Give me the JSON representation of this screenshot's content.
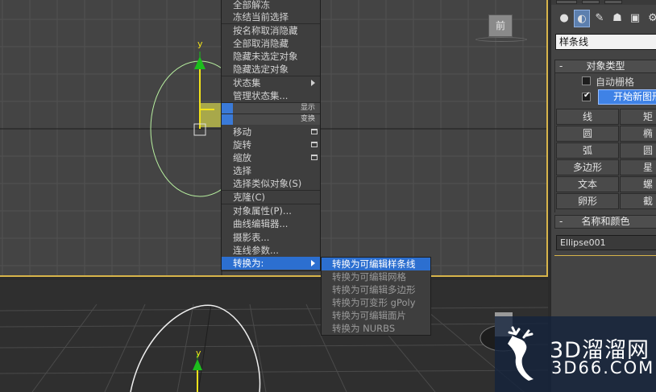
{
  "viewport_top": {
    "view_cube_label": "前",
    "axis_y_label": "y"
  },
  "viewport_persp": {
    "axis_y_label": "y"
  },
  "quad_menu": {
    "items": [
      {
        "label": "全部解冻"
      },
      {
        "label": "冻结当前选择"
      },
      {
        "label": "按名称取消隐藏"
      },
      {
        "label": "全部取消隐藏"
      },
      {
        "label": "隐藏未选定对象"
      },
      {
        "label": "隐藏选定对象"
      },
      {
        "label": "状态集"
      },
      {
        "label": "管理状态集..."
      }
    ],
    "display_header": "显示",
    "transform_header": "变换",
    "transform_items": [
      {
        "label": "移动"
      },
      {
        "label": "旋转"
      },
      {
        "label": "缩放"
      },
      {
        "label": "选择"
      },
      {
        "label": "选择类似对象(S)"
      },
      {
        "label": "克隆(C)"
      },
      {
        "label": "对象属性(P)..."
      },
      {
        "label": "曲线编辑器..."
      },
      {
        "label": "摄影表..."
      },
      {
        "label": "连线参数..."
      },
      {
        "label": "转换为:"
      }
    ]
  },
  "submenu": {
    "items": [
      {
        "label": "转换为可编辑样条线"
      },
      {
        "label": "转换为可编辑网格"
      },
      {
        "label": "转换为可编辑多边形"
      },
      {
        "label": "转换为可变形 gPoly"
      },
      {
        "label": "转换为可编辑面片"
      },
      {
        "label": "转换为 NURBS"
      }
    ]
  },
  "command_panel": {
    "category_dropdown": "样条线",
    "object_type": {
      "title": "对象类型",
      "autogrid_label": "自动栅格",
      "start_new_shape_label": "开始新图形",
      "buttons": [
        {
          "left": "线",
          "right": "矩形"
        },
        {
          "left": "圆",
          "right": "椭圆"
        },
        {
          "left": "弧",
          "right": "圆环"
        },
        {
          "left": "多边形",
          "right": "星形"
        },
        {
          "left": "文本",
          "right": "螺旋线"
        },
        {
          "left": "卵形",
          "right": "截面"
        }
      ]
    },
    "name_color": {
      "title": "名称和颜色",
      "name_value": "Ellipse001"
    }
  },
  "watermark": {
    "text": "3D溜溜网",
    "url": "3D66.COM"
  }
}
